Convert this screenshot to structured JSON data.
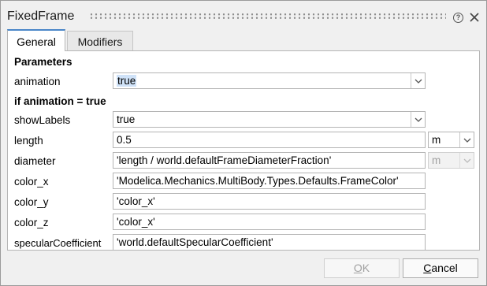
{
  "window": {
    "title": "FixedFrame",
    "help_icon": "help-icon",
    "close_icon": "close-icon"
  },
  "tabs": [
    {
      "label": "General",
      "active": true
    },
    {
      "label": "Modifiers",
      "active": false
    }
  ],
  "sections": {
    "parameters": "Parameters",
    "if_animation": "if animation = true"
  },
  "params": {
    "animation": {
      "label": "animation",
      "value": "true"
    },
    "showLabels": {
      "label": "showLabels",
      "value": "true"
    },
    "length": {
      "label": "length",
      "value": "0.5",
      "unit": "m"
    },
    "diameter": {
      "label": "diameter",
      "value": "'length / world.defaultFrameDiameterFraction'",
      "unit": "m"
    },
    "color_x": {
      "label": "color_x",
      "value": "'Modelica.Mechanics.MultiBody.Types.Defaults.FrameColor'"
    },
    "color_y": {
      "label": "color_y",
      "value": "'color_x'"
    },
    "color_z": {
      "label": "color_z",
      "value": "'color_x'"
    },
    "specularCoefficient": {
      "label": "specularCoefficient",
      "value": "'world.defaultSpecularCoefficient'"
    }
  },
  "buttons": {
    "ok": {
      "key": "O",
      "rest": "K"
    },
    "cancel": {
      "key": "C",
      "rest": "ancel"
    }
  },
  "colors": {
    "active_tab_accent": "#4a86c8",
    "selection_highlight": "#cfe2f8"
  }
}
